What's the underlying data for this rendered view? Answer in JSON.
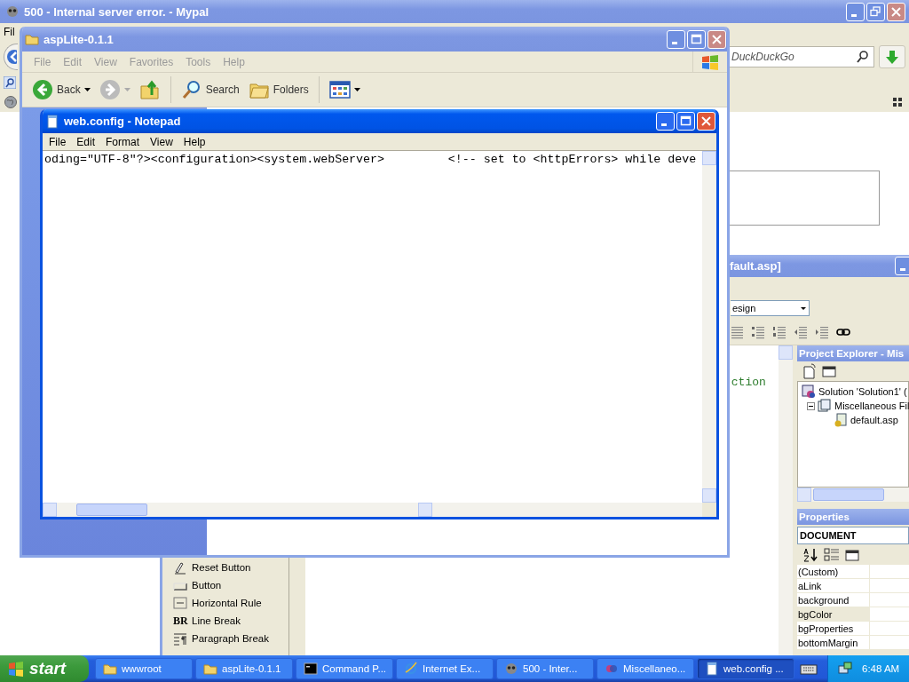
{
  "browser_window": {
    "title": "500 - Internal server error. - Mypal",
    "menu": [
      "Fil"
    ],
    "search": {
      "placeholder": "DuckDuckGo"
    }
  },
  "ide_window": {
    "title": "fault.asp]",
    "view_dropdown": "esign",
    "code_text": "ction",
    "toolbox": [
      {
        "label": "Reset Button",
        "kind": "reset"
      },
      {
        "label": "Button",
        "kind": "button"
      },
      {
        "label": "Horizontal Rule",
        "kind": "rule"
      },
      {
        "label": "Line Break",
        "kind": "text",
        "icon_text": "BR"
      },
      {
        "label": "Paragraph Break",
        "kind": "paragraph"
      }
    ],
    "project_explorer": {
      "title": "Project Explorer - Mis",
      "tree": [
        {
          "label": "Solution 'Solution1' (",
          "kind": "solution",
          "children": [
            {
              "label": "Miscellaneous Fil",
              "kind": "folder",
              "expanded": true,
              "children": [
                {
                  "label": "default.asp",
                  "kind": "file"
                }
              ]
            }
          ]
        }
      ]
    },
    "properties": {
      "title": "Properties",
      "object": "DOCUMENT",
      "rows": [
        {
          "name": "(Custom)",
          "selected": false
        },
        {
          "name": "aLink",
          "selected": false
        },
        {
          "name": "background",
          "selected": false
        },
        {
          "name": "bgColor",
          "selected": true
        },
        {
          "name": "bgProperties",
          "selected": false
        },
        {
          "name": "bottomMargin",
          "selected": false
        }
      ]
    }
  },
  "explorer_window": {
    "title": "aspLite-0.1.1",
    "menu": [
      "File",
      "Edit",
      "View",
      "Favorites",
      "Tools",
      "Help"
    ],
    "toolbar": [
      {
        "kind": "back",
        "label": "Back"
      },
      {
        "kind": "forward"
      },
      {
        "kind": "up"
      },
      {
        "kind": "separator"
      },
      {
        "kind": "search",
        "label": "Search"
      },
      {
        "kind": "folders",
        "label": "Folders"
      },
      {
        "kind": "separator"
      },
      {
        "kind": "views"
      }
    ]
  },
  "notepad": {
    "title": "web.config - Notepad",
    "menu": [
      "File",
      "Edit",
      "Format",
      "View",
      "Help"
    ],
    "text": "oding=\"UTF-8\"?><configuration><system.webServer>         <!-- set to <httpErrors> while deve"
  },
  "taskbar": {
    "start": "start",
    "items": [
      {
        "label": "wwwroot",
        "kind": "folder",
        "selected": false
      },
      {
        "label": "aspLite-0.1.1",
        "kind": "folder",
        "selected": false
      },
      {
        "label": "Command P...",
        "kind": "console",
        "selected": false
      },
      {
        "label": "Internet Ex...",
        "kind": "browser",
        "selected": false
      },
      {
        "label": "500 - Inter...",
        "kind": "app",
        "selected": false
      },
      {
        "label": "Miscellaneo...",
        "kind": "ide",
        "selected": false
      },
      {
        "label": "web.config ...",
        "kind": "notepad",
        "selected": true
      }
    ],
    "clock": "6:48 AM"
  }
}
